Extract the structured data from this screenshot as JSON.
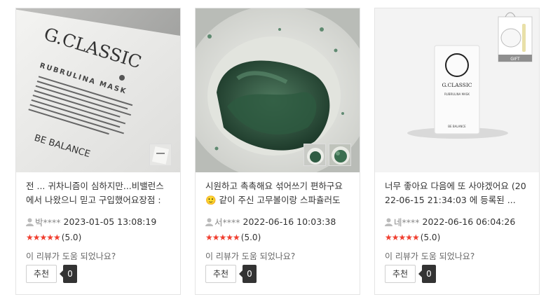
{
  "reviews": [
    {
      "text": "전 ... 귀차니즘이 심하지만...비밸런스에서 나왔으니 믿고 구입했어요장점 : 1. ...",
      "author": "박****",
      "date": "2023-01-05 13:08:19",
      "stars": "★★★★★",
      "rating": "(5.0)",
      "helpful_question": "이 리뷰가 도움 되었나요?",
      "recommend_label": "추천",
      "recommend_count": "0",
      "photo_brand": "G.CLASSIC",
      "photo_sub": "RUBRULINA MASK",
      "photo_logo": "BE BALANCE"
    },
    {
      "text": "시원하고 촉촉해요 섞어쓰기 편하구요 🙂 같이 주신 고무볼이랑 스파츌러도 ...",
      "author": "서****",
      "date": "2022-06-16 10:03:38",
      "stars": "★★★★★",
      "rating": "(5.0)",
      "helpful_question": "이 리뷰가 도움 되었나요?",
      "recommend_label": "추천",
      "recommend_count": "0"
    },
    {
      "text": "너무 좋아요 다음에 또 사야겠어요 (2022-06-15 21:34:03 에 등록된 ...",
      "author": "네****",
      "date": "2022-06-16 06:04:26",
      "stars": "★★★★★",
      "rating": "(5.0)",
      "helpful_question": "이 리뷰가 도움 되었나요?",
      "recommend_label": "추천",
      "recommend_count": "0",
      "photo_brand": "G.CLASSIC",
      "photo_sub": "RUBRULINA MASK",
      "photo_logo": "BE BALANCE",
      "photo_gift": "GIFT"
    }
  ]
}
